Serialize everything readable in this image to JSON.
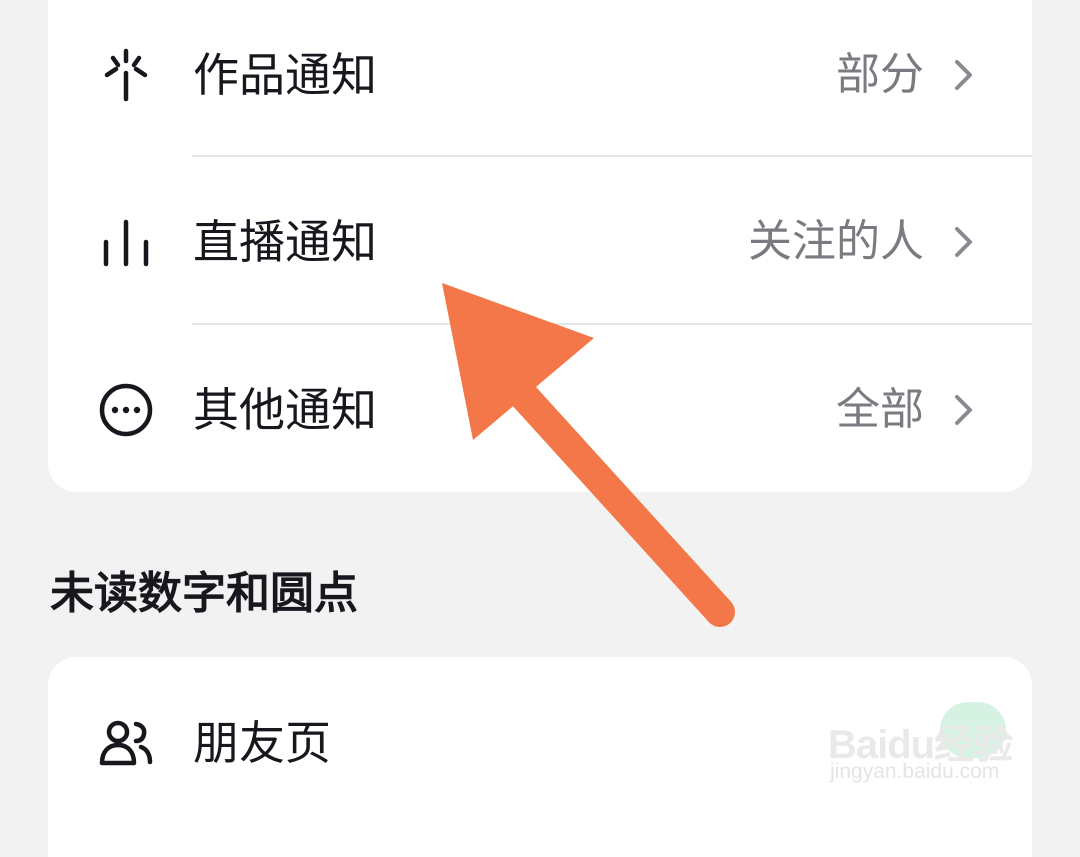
{
  "notification_settings": {
    "rows": [
      {
        "icon": "sparkle-icon",
        "label": "作品通知",
        "value": "部分"
      },
      {
        "icon": "bar-chart-icon",
        "label": "直播通知",
        "value": "关注的人"
      },
      {
        "icon": "more-circle-icon",
        "label": "其他通知",
        "value": "全部"
      }
    ]
  },
  "unread_section": {
    "title": "未读数字和圆点",
    "rows": [
      {
        "icon": "friends-icon",
        "label": "朋友页"
      }
    ]
  },
  "overlay": {
    "arrow_color": "#f37748",
    "points_to": "直播通知"
  },
  "watermark": {
    "main": "Baidu经验",
    "sub": "jingyan.baidu.com"
  }
}
